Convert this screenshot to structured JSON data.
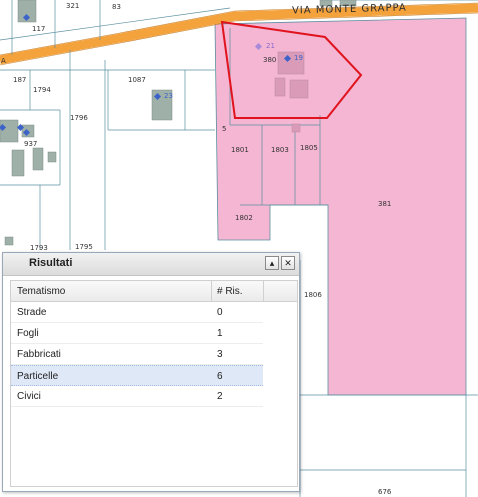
{
  "map": {
    "road_name": "VIA MONTE GRAPPA",
    "parcel_labels": [
      "321",
      "83",
      "117",
      "1087",
      "187",
      "1794",
      "1796",
      "937",
      "5",
      "380",
      "1801",
      "1803",
      "1805",
      "1802",
      "381",
      "1793",
      "1795",
      "1806",
      "676",
      "21",
      "19",
      "23",
      "A"
    ],
    "colors": {
      "parcel_highlight": "#f4b6d2",
      "selection_outline": "#e0141e",
      "road": "#f4a23c",
      "building": "#9fb0a8",
      "address_point": "#3d63c9",
      "parcel_border": "#5a8fa0"
    }
  },
  "results_panel": {
    "title": "Risultati",
    "columns": {
      "name": "Tematismo",
      "count": "# Ris."
    },
    "rows": [
      {
        "name": "Strade",
        "count": "0",
        "selected": false
      },
      {
        "name": "Fogli",
        "count": "1",
        "selected": false
      },
      {
        "name": "Fabbricati",
        "count": "3",
        "selected": false
      },
      {
        "name": "Particelle",
        "count": "6",
        "selected": true
      },
      {
        "name": "Civici",
        "count": "2",
        "selected": false
      }
    ],
    "buttons": {
      "collapse_icon": "chevron-up-icon",
      "close_icon": "close-icon"
    }
  }
}
